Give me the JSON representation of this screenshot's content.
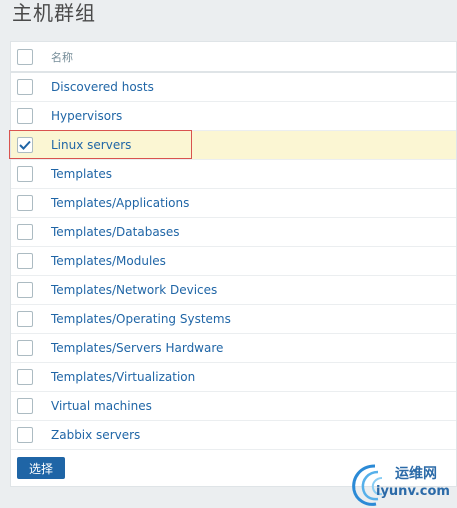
{
  "page": {
    "title": "主机群组"
  },
  "table": {
    "header_label": "名称",
    "rows": [
      {
        "label": "Discovered hosts",
        "checked": false
      },
      {
        "label": "Hypervisors",
        "checked": false
      },
      {
        "label": "Linux servers",
        "checked": true
      },
      {
        "label": "Templates",
        "checked": false
      },
      {
        "label": "Templates/Applications",
        "checked": false
      },
      {
        "label": "Templates/Databases",
        "checked": false
      },
      {
        "label": "Templates/Modules",
        "checked": false
      },
      {
        "label": "Templates/Network Devices",
        "checked": false
      },
      {
        "label": "Templates/Operating Systems",
        "checked": false
      },
      {
        "label": "Templates/Servers Hardware",
        "checked": false
      },
      {
        "label": "Templates/Virtualization",
        "checked": false
      },
      {
        "label": "Virtual machines",
        "checked": false
      },
      {
        "label": "Zabbix servers",
        "checked": false
      }
    ]
  },
  "actions": {
    "select_label": "选择"
  },
  "watermark": {
    "line1": "运维网",
    "line2": "iyunv.com"
  },
  "colors": {
    "link": "#1f65a6",
    "selected_row": "#fbf6d3",
    "button": "#1f65a6",
    "highlight_border": "#d9534f"
  }
}
